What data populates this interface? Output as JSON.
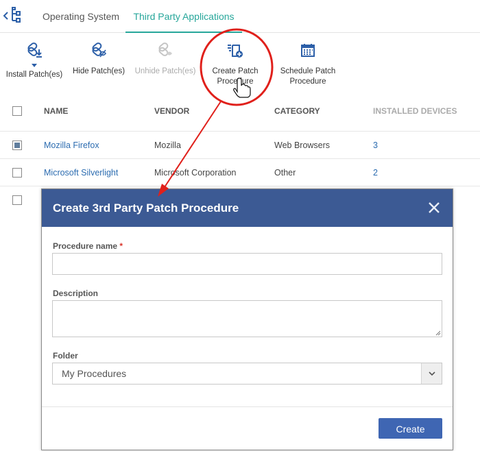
{
  "tabs": [
    {
      "label": "Operating System"
    },
    {
      "label": "Third Party Applications"
    }
  ],
  "toolbar": {
    "install_label": "Install Patch(es)",
    "hide_label": "Hide Patch(es)",
    "unhide_label": "Unhide Patch(es)",
    "create_line1": "Create Patch",
    "create_line2": "Procedure",
    "schedule_line1": "Schedule Patch",
    "schedule_line2": "Procedure"
  },
  "grid": {
    "columns": [
      "NAME",
      "VENDOR",
      "CATEGORY",
      "INSTALLED DEVICES"
    ],
    "rows": [
      {
        "name": "Mozilla Firefox",
        "vendor": "Mozilla",
        "category": "Web Browsers",
        "installed": "3",
        "checked": true
      },
      {
        "name": "Microsoft Silverlight",
        "vendor": "Microsoft Corporation",
        "category": "Other",
        "installed": "2",
        "checked": false
      }
    ]
  },
  "modal": {
    "title": "Create 3rd Party Patch Procedure",
    "name_label": "Procedure name",
    "required_mark": "*",
    "name_value": "",
    "description_label": "Description",
    "folder_label": "Folder",
    "folder_value": "My Procedures",
    "create_label": "Create"
  },
  "colors": {
    "accent_tab": "#26a69a",
    "modal_header": "#3c5a94",
    "primary_button": "#3f66b3",
    "annotation": "#e0201b",
    "link": "#2c6cb0"
  }
}
